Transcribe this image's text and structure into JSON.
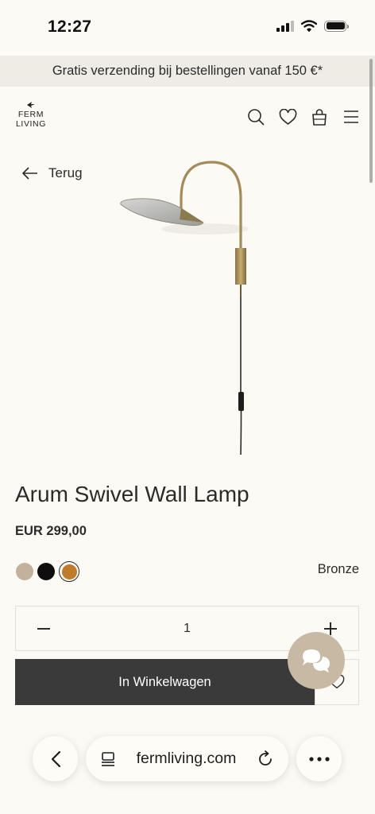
{
  "status_bar": {
    "time": "12:27"
  },
  "promo": {
    "text": "Gratis verzending bij bestellingen vanaf 150 €*"
  },
  "header": {
    "logo_line1": "FERM",
    "logo_line2": "LIVING",
    "icons": [
      "search-icon",
      "heart-icon",
      "bag-icon",
      "menu-icon"
    ]
  },
  "nav": {
    "back_label": "Terug"
  },
  "product": {
    "title": "Arum Swivel Wall Lamp",
    "price": "EUR 299,00",
    "selected_color": "Bronze",
    "swatches": [
      {
        "name": "cashmere",
        "color": "#c2b19b"
      },
      {
        "name": "black",
        "color": "#0e0e0e"
      },
      {
        "name": "bronze",
        "color": "#c07a2c",
        "selected": true
      }
    ],
    "quantity": "1",
    "add_to_cart_label": "In Winkelwagen"
  },
  "browser": {
    "url": "fermliving.com"
  },
  "colors": {
    "accent": "#3a3a3a",
    "background": "#fbfaf4",
    "chat": "#c8b9a4"
  }
}
